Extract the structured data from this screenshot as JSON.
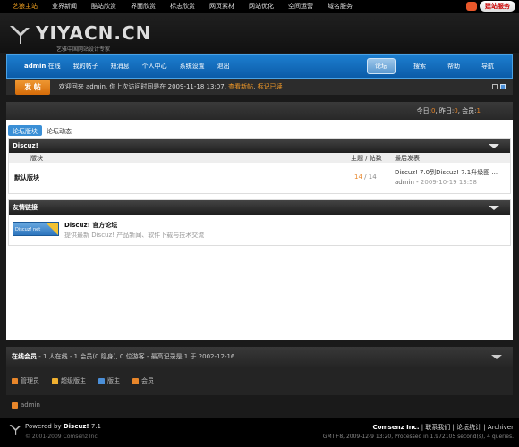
{
  "topbar": {
    "links": [
      "艺狼主站",
      "业界新闻",
      "酷站欣赏",
      "界面欣赏",
      "标志欣赏",
      "网页素材",
      "网站优化",
      "空间运营",
      "域名服务"
    ],
    "service_button": "建站服务"
  },
  "header": {
    "logo_text": "YIYACN.CN",
    "logo_sub": "艺雅中国网站设计专家"
  },
  "nav": {
    "user": "admin",
    "status": "在线",
    "items": [
      "我的帖子",
      "短消息",
      "个人中心",
      "系统设置",
      "退出"
    ],
    "tabs": [
      "论坛",
      "搜索",
      "帮助",
      "导航"
    ]
  },
  "notice": {
    "post_button": "发 帖",
    "message": "欢迎回来 admin, 你上次访问时间是在 2009-11-18 13:07,",
    "link1": "查看新帖",
    "link2": "标记已读"
  },
  "stats": {
    "today_label": "今日:",
    "today": "0",
    "yesterday_label": "昨日:",
    "yesterday": "0",
    "members_label": "会员:",
    "members": "1"
  },
  "main": {
    "tabs": [
      "论坛版块",
      "论坛动态"
    ],
    "forum_section": "Discuz!",
    "columns": {
      "forum": "版块",
      "count": "主题 / 帖数",
      "last": "最后发表"
    },
    "forum": {
      "name": "默认版块",
      "topics": "14",
      "posts": "14",
      "last_title": "Discuz! 7.0到Discuz! 7.1升级图 ...",
      "last_author": "admin",
      "last_date": "2009-10-19 13:58"
    },
    "links_section": "友情链接",
    "link": {
      "logo": "Discuz! net",
      "title": "Discuz! 官方论坛",
      "desc": "提供最新 Discuz! 产品新闻、软件下载与技术交流"
    }
  },
  "online": {
    "title": "在线会员",
    "summary": "- 1 人在线 - 1 会员(0 隐身), 0 位游客 - 最高记录是 1 于 2002-12-16.",
    "roles": [
      {
        "label": "管理员",
        "color": "#e8862a"
      },
      {
        "label": "超级版主",
        "color": "#f0b030"
      },
      {
        "label": "版主",
        "color": "#4b8fd8"
      },
      {
        "label": "会员",
        "color": "#e8862a"
      }
    ],
    "user": "admin"
  },
  "footer": {
    "powered_prefix": "Powered by",
    "powered_brand": "Discuz!",
    "version": "7.1",
    "copyright": "© 2001-2009 Comsenz Inc.",
    "company": "Comsenz Inc.",
    "links": "| 联系我们 | 论坛统计 | Archiver",
    "gmt": "GMT+8, 2009-12-9 13:20, Processed in 1.972105 second(s), 4 queries."
  }
}
